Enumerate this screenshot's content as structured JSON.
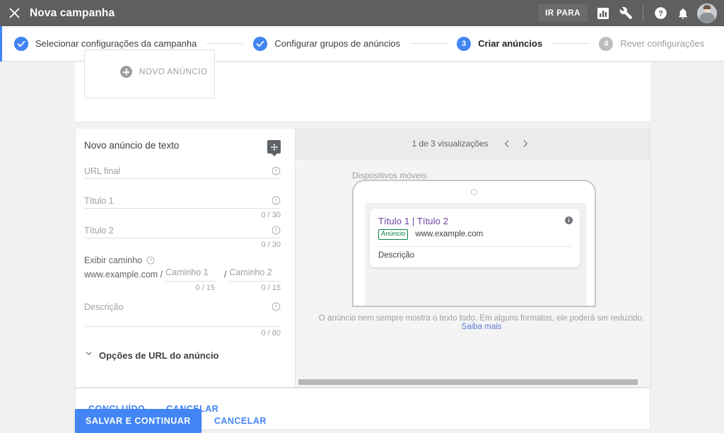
{
  "topbar": {
    "close_icon": "close-icon",
    "title": "Nova campanha",
    "goto_label": "IR PARA",
    "reports_icon": "bar-chart-icon",
    "tools_icon": "wrench-icon",
    "help_icon": "help-circle-icon",
    "notifications_icon": "bell-icon",
    "avatar": "user-avatar",
    "bg_color": "#5f5f5f"
  },
  "stepper": {
    "accent_color": "#4285f4",
    "steps": [
      {
        "badge": "check",
        "number": "",
        "label": "Selecionar configurações da campanha",
        "state": "done"
      },
      {
        "badge": "check",
        "number": "",
        "label": "Configurar grupos de anúncios",
        "state": "done"
      },
      {
        "badge": "number",
        "number": "3",
        "label": "Criar anúncios",
        "state": "active"
      },
      {
        "badge": "number",
        "number": "4",
        "label": "Rever configurações",
        "state": "todo"
      }
    ]
  },
  "new_ad_card": {
    "label": "NOVO ANÚNCIO",
    "plus_icon": "plus-circle-icon"
  },
  "form": {
    "title": "Novo anúncio de texto",
    "drag_icon": "move-arrows-icon",
    "help_icon": "help-circle-outline-icon",
    "fields": [
      {
        "label": "URL final",
        "value": "",
        "counter": ""
      },
      {
        "label": "Título 1",
        "value": "",
        "counter": "0 / 30"
      },
      {
        "label": "Título 2",
        "value": "",
        "counter": "0 / 30"
      }
    ],
    "path": {
      "label": "Exibir caminho",
      "domain": "www.example.com /",
      "seg1_placeholder": "Caminho 1",
      "seg1_value": "",
      "seg1_counter": "0 / 15",
      "slash": "/",
      "seg2_placeholder": "Caminho 2",
      "seg2_value": "",
      "seg2_counter": "0 / 15"
    },
    "description": {
      "label": "Descrição",
      "value": "",
      "counter": "0 / 80"
    },
    "url_options": {
      "label": "Opções de URL do anúncio",
      "chevron_icon": "chevron-down-icon"
    }
  },
  "preview": {
    "count_text": "1 de 3 visualizações",
    "prev_icon": "chevron-left-icon",
    "next_icon": "chevron-right-icon",
    "device_label": "Dispositivos móveis",
    "ad": {
      "title": "Título 1 | Título 2",
      "badge": "Anúncio",
      "url": "www.example.com",
      "description": "Descrição",
      "info_icon": "info-icon",
      "title_color": "#6b3fa0",
      "badge_color": "#0a8043"
    },
    "note_text": "O anúncio nem sempre mostra o texto todo. Em alguns formatos, ele poderá ser reduzido. ",
    "note_link": "Saiba mais"
  },
  "editor_footer": {
    "done_label": "CONCLUÍDO",
    "cancel_label": "CANCELAR"
  },
  "bottom_actions": {
    "save_label": "SALVAR E CONTINUAR",
    "cancel_label": "CANCELAR",
    "primary_color": "#4285f4"
  }
}
